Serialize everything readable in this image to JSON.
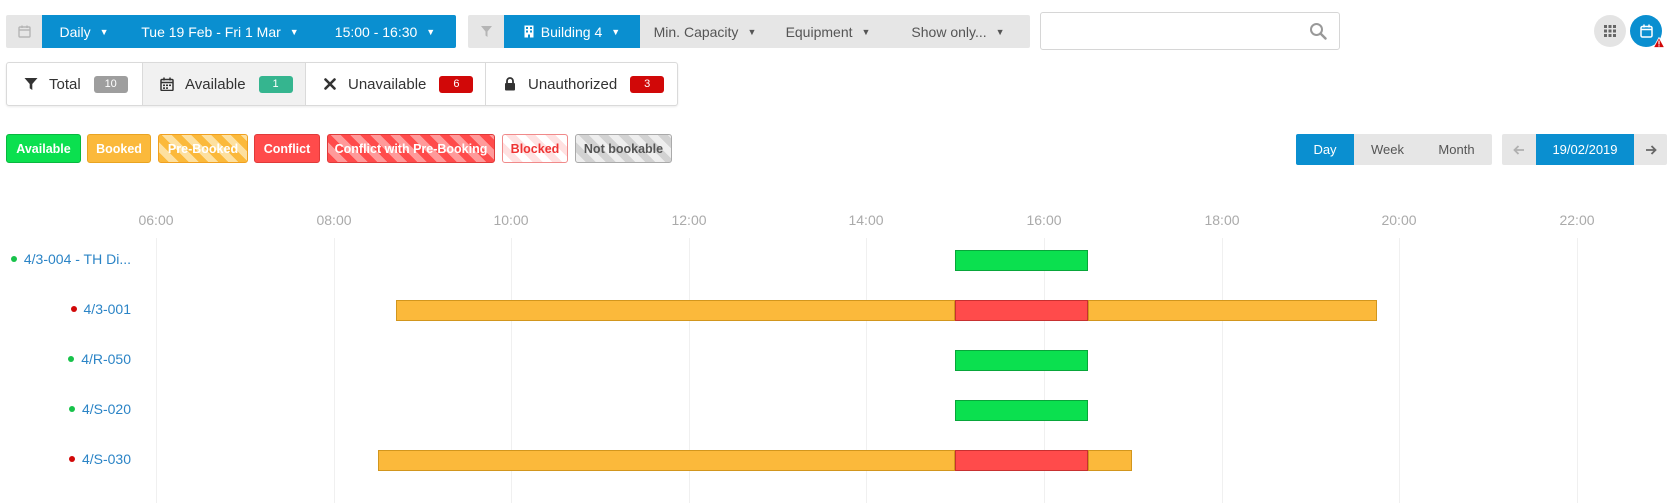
{
  "toolbar": {
    "period_label": "Daily",
    "date_range": "Tue 19 Feb - Fri 1 Mar",
    "time_range": "15:00 - 16:30",
    "building_label": "Building 4",
    "min_capacity_label": "Min. Capacity",
    "equipment_label": "Equipment",
    "show_only_label": "Show only...",
    "search_placeholder": ""
  },
  "stats": [
    {
      "label": "Total",
      "count": "10",
      "icon": "funnel-icon",
      "color": "#9e9e9e"
    },
    {
      "label": "Available",
      "count": "1",
      "icon": "calendar-icon",
      "color": "#35b58f"
    },
    {
      "label": "Unavailable",
      "count": "6",
      "icon": "times-icon",
      "color": "#d10808"
    },
    {
      "label": "Unauthorized",
      "count": "3",
      "icon": "lock-icon",
      "color": "#d10808"
    }
  ],
  "legend": [
    {
      "label": "Available",
      "style": "available"
    },
    {
      "label": "Booked",
      "style": "booked"
    },
    {
      "label": "Pre-Booked",
      "style": "pre-booked"
    },
    {
      "label": "Conflict",
      "style": "conflict"
    },
    {
      "label": "Conflict with Pre-Booking",
      "style": "conflict-pre-booking"
    },
    {
      "label": "Blocked",
      "style": "blocked"
    },
    {
      "label": "Not bookable",
      "style": "not-bookable"
    }
  ],
  "view_modes": {
    "day": "Day",
    "week": "Week",
    "month": "Month",
    "active": "Day"
  },
  "date_nav": {
    "current": "19/02/2019"
  },
  "timeline": {
    "hours": [
      "06:00",
      "08:00",
      "10:00",
      "12:00",
      "14:00",
      "16:00",
      "18:00",
      "20:00",
      "22:00"
    ],
    "rows": [
      {
        "name": "4/3-004 - TH Di...",
        "status": "available",
        "bars": [
          {
            "type": "available",
            "start": 15.0,
            "end": 16.5
          }
        ]
      },
      {
        "name": "4/3-001",
        "status": "unavailable",
        "bars": [
          {
            "type": "booked",
            "start": 8.7,
            "end": 15.0
          },
          {
            "type": "conflict",
            "start": 15.0,
            "end": 16.5
          },
          {
            "type": "booked",
            "start": 16.5,
            "end": 19.75
          }
        ]
      },
      {
        "name": "4/R-050",
        "status": "available",
        "bars": [
          {
            "type": "available",
            "start": 15.0,
            "end": 16.5
          }
        ]
      },
      {
        "name": "4/S-020",
        "status": "available",
        "bars": [
          {
            "type": "available",
            "start": 15.0,
            "end": 16.5
          }
        ]
      },
      {
        "name": "4/S-030",
        "status": "unavailable",
        "bars": [
          {
            "type": "booked",
            "start": 8.5,
            "end": 15.0
          },
          {
            "type": "conflict",
            "start": 15.0,
            "end": 16.5
          },
          {
            "type": "booked",
            "start": 16.5,
            "end": 17.0
          }
        ]
      }
    ]
  },
  "colors": {
    "primary": "#0a8fd0",
    "available": "#0be04f",
    "booked": "#fbb93b",
    "conflict": "#ff4b4b",
    "link": "#2b84c6",
    "status_available_dot": "#17c24a",
    "status_unavailable_dot": "#d10808"
  }
}
